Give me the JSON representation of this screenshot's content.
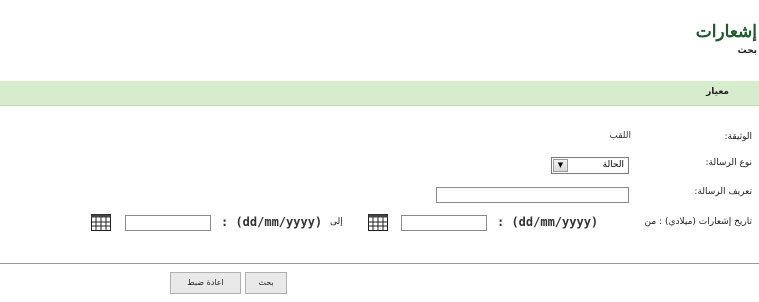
{
  "header": {
    "title": "إشعارات",
    "subtitle": "بحث"
  },
  "criteria": {
    "label": "معيار"
  },
  "form": {
    "document_label": "الوثيقة:",
    "document_value": "اللقب",
    "message_type_label": "نوع الرسالة:",
    "message_type_selected": "الحالة",
    "message_id_label": "تعريف الرسالة:",
    "message_id_value": "",
    "date_label": "تاريخ إشعارات (ميلادي) : من",
    "date_to_label": "إلى",
    "date_format_from": ": (dd/mm/yyyy)",
    "date_format_to": ": (dd/mm/yyyy)",
    "date_from_value": "",
    "date_to_value": ""
  },
  "buttons": {
    "search": "بحث",
    "reset": "اعادة ضبط"
  },
  "icons": {
    "date_from": "calendar-icon",
    "date_to": "calendar-icon"
  }
}
